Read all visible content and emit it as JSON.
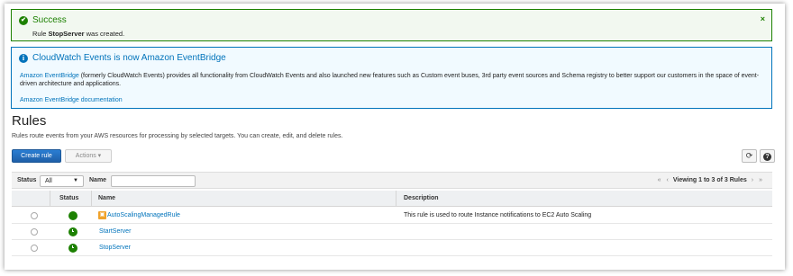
{
  "success": {
    "title": "Success",
    "message_prefix": "Rule ",
    "rule_name": "StopServer",
    "message_suffix": " was created.",
    "close": "×"
  },
  "info": {
    "title": "CloudWatch Events is now Amazon EventBridge",
    "link_text": "Amazon EventBridge",
    "body_text": " (formerly CloudWatch Events) provides all functionality from CloudWatch Events and also launched new features such as Custom event buses, 3rd party event sources and Schema registry to better support our customers in the space of event-driven architecture and applications.",
    "doc_link": "Amazon EventBridge documentation"
  },
  "page": {
    "title": "Rules",
    "description": "Rules route events from your AWS resources for processing by selected targets. You can create, edit, and delete rules."
  },
  "toolbar": {
    "create_label": "Create rule",
    "actions_label": "Actions ▾",
    "refresh_icon": "refresh-icon",
    "help_icon": "help-icon"
  },
  "filter": {
    "status_label": "Status",
    "status_value": "All",
    "name_label": "Name",
    "name_value": "",
    "pager_first": "«",
    "pager_prev": "‹",
    "pager_text": "Viewing 1 to 3 of 3 Rules",
    "pager_next": "›",
    "pager_last": "»"
  },
  "table": {
    "headers": [
      "Status",
      "Name",
      "Description"
    ],
    "rows": [
      {
        "name": "AutoScalingManagedRule",
        "description": "This rule is used to route Instance notifications to EC2 Auto Scaling",
        "managed": true
      },
      {
        "name": "StartServer",
        "description": "",
        "managed": false
      },
      {
        "name": "StopServer",
        "description": "",
        "managed": false
      }
    ]
  },
  "colors": {
    "success": "#1d8102",
    "info": "#0073bb",
    "primary_button": "#1f5fa8"
  }
}
